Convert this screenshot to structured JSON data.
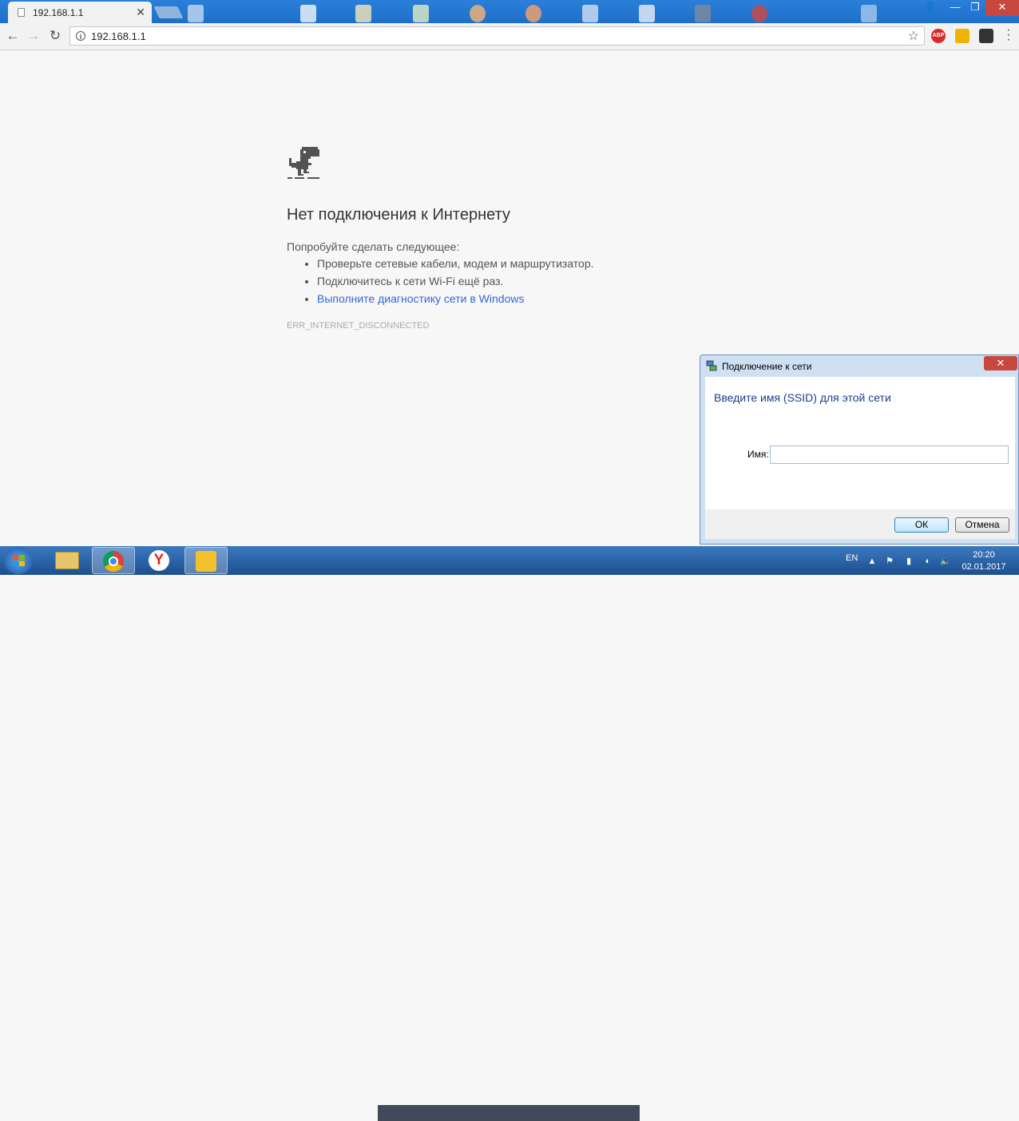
{
  "browser": {
    "tab_title": "192.168.1.1",
    "url": "192.168.1.1"
  },
  "error_page": {
    "title": "Нет подключения к Интернету",
    "try_text": "Попробуйте сделать следующее:",
    "suggestions": [
      "Проверьте сетевые кабели, модем и маршрутизатор.",
      "Подключитесь к сети Wi-Fi ещё раз."
    ],
    "diagnostics_link": "Выполните диагностику сети в Windows",
    "error_code": "ERR_INTERNET_DISCONNECTED"
  },
  "dialog": {
    "title": "Подключение к сети",
    "heading": "Введите имя (SSID) для этой сети",
    "name_label": "Имя:",
    "name_value": "",
    "ok_label": "ОК",
    "cancel_label": "Отмена"
  },
  "taskbar": {
    "language": "EN",
    "time": "20:20",
    "date": "02.01.2017"
  },
  "icons": {
    "back": "arrow-left",
    "forward": "arrow-right",
    "reload": "reload",
    "info": "info-circle",
    "bookmark": "star-outline",
    "close": "x"
  },
  "colors": {
    "tabstrip": "#2a7fd8",
    "link": "#3367d6",
    "dialog_heading": "#1b3e8c",
    "close_red": "#c7463d"
  }
}
